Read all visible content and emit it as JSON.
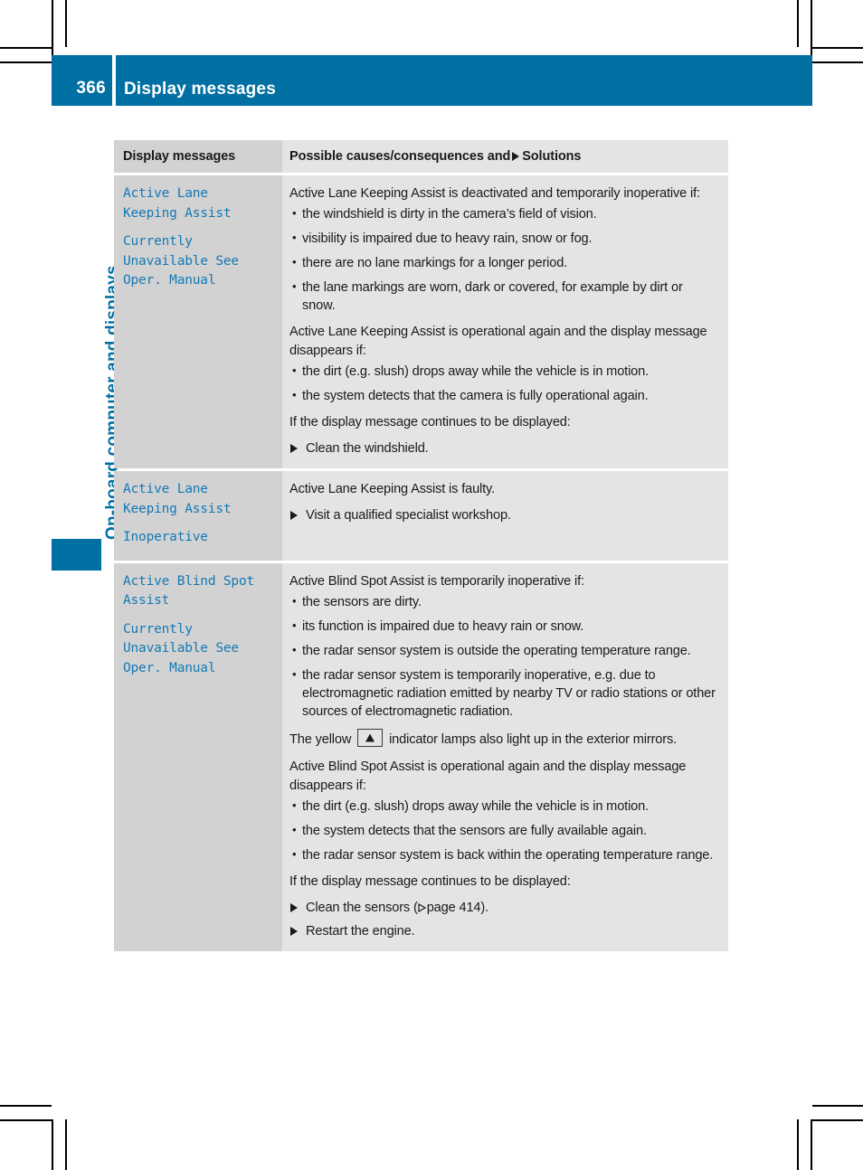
{
  "header": {
    "page_number": "366",
    "title": "Display messages"
  },
  "chapter": {
    "label": "On-board computer and displays"
  },
  "table": {
    "columns": {
      "left_header": "Display messages",
      "right_header_before": "Possible causes/consequences and",
      "right_header_after": "Solutions"
    },
    "rows": [
      {
        "message": "Active Lane\nKeeping Assist",
        "message2": "Currently\nUnavailable See\nOper. Manual",
        "intro": "Active Lane Keeping Assist is deactivated and temporarily inoperative if:",
        "bullets": [
          "the windshield is dirty in the camera’s field of vision.",
          "visibility is impaired due to heavy rain, snow or fog.",
          "there are no lane markings for a longer period.",
          "the lane markings are worn, dark or covered, for example by dirt or snow."
        ],
        "second_para": "Active Lane Keeping Assist is operational again and the display message disappears if:",
        "bullets2": [
          "the dirt (e.g. slush) drops away while the vehicle is in motion.",
          "the system detects that the camera is fully operational again."
        ],
        "third_para": "If the display message continues to be displayed:",
        "solutions": [
          "Clean the windshield."
        ]
      },
      {
        "message": "Active Lane\nKeeping Assist",
        "message2": "Inoperative",
        "intro": "Active Lane Keeping Assist is faulty.",
        "solutions": [
          "Visit a qualified specialist workshop."
        ]
      },
      {
        "message": "Active Blind Spot\nAssist",
        "message2": "Currently\nUnavailable See\nOper. Manual",
        "intro": "Active Blind Spot Assist is temporarily inoperative if:",
        "bullets": [
          "the sensors are dirty.",
          "its function is impaired due to heavy rain or snow.",
          "the radar sensor system is outside the operating temperature range.",
          "the radar sensor system is temporarily inoperative, e.g. due to electromagnetic radiation emitted by nearby TV or radio stations or other sources of electromagnetic radiation."
        ],
        "lamp_para_before": "The yellow",
        "lamp_para_after": "indicator lamps also light up in the exterior mirrors.",
        "second_para": "Active Blind Spot Assist is operational again and the display message disappears if:",
        "bullets2": [
          "the dirt (e.g. slush) drops away while the vehicle is in motion.",
          "the system detects that the sensors are fully available again.",
          "the radar sensor system is back within the operating temperature range."
        ],
        "third_para": "If the display message continues to be displayed:",
        "solution_ref_before": "Clean the sensors (",
        "solution_ref_page": "page 414",
        "solution_ref_after": ").",
        "solutions": [
          "Restart the engine."
        ]
      }
    ]
  },
  "colors": {
    "brand_blue": "#0070a3",
    "code_blue": "#1479b5",
    "left_cell_gray": "#d2d2d2",
    "right_cell_gray": "#e4e4e4",
    "text_dark": "#1a1a1a"
  }
}
